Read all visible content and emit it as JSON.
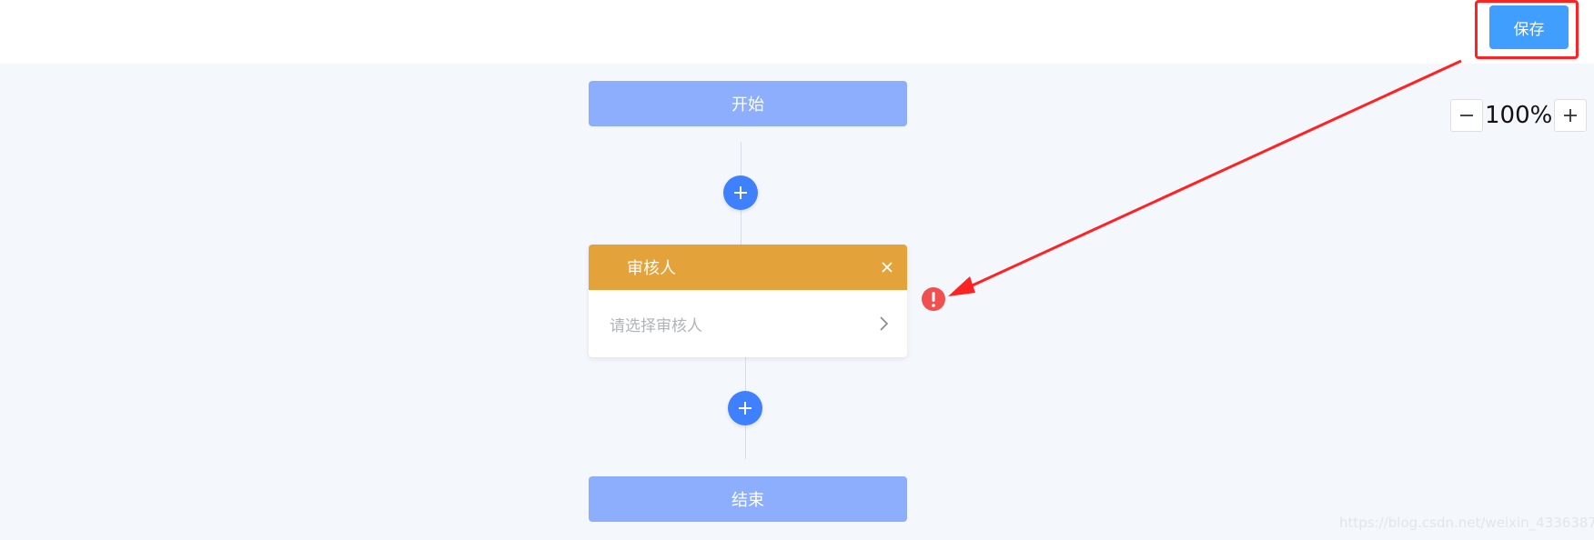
{
  "toolbar": {
    "save_label": "保存"
  },
  "zoom": {
    "value": "100%",
    "minus_icon": "minus-icon",
    "plus_icon": "plus-icon"
  },
  "flow": {
    "start_label": "开始",
    "end_label": "结束",
    "approver_node": {
      "title": "审核人",
      "placeholder": "请选择审核人",
      "close_icon": "close-icon",
      "chevron_icon": "chevron-right-icon"
    },
    "add_icon": "plus-icon",
    "error_icon": "exclamation-icon"
  },
  "colors": {
    "canvas": "#f4f7fc",
    "start_end": "#8caefc",
    "approver_header": "#e4a23a",
    "add_button": "#3f80ff",
    "save_button": "#409eff",
    "error": "#f05050",
    "annotation": "#ff2222"
  },
  "watermark": "https://blog.csdn.net/weixin_43363871"
}
